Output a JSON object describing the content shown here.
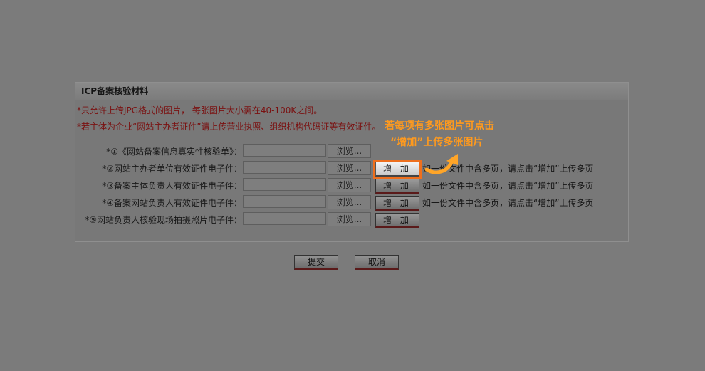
{
  "panel": {
    "title": "ICP备案核验材料",
    "notice1": "*只允许上传JPG格式的图片， 每张图片大小需在40-100K之间。",
    "notice2": "*若主体为企业“网站主办者证件”请上传营业执照、组织机构代码证等有效证件。"
  },
  "rows": [
    {
      "label": "*①《网站备案信息真实性核验单》：",
      "browse": "浏览...",
      "add": "",
      "hint": ""
    },
    {
      "label": "*②网站主办者单位有效证件电子件：",
      "browse": "浏览...",
      "add": "增 加",
      "hint": "如一份文件中含多页，请点击“增加”上传多页"
    },
    {
      "label": "*③备案主体负责人有效证件电子件：",
      "browse": "浏览...",
      "add": "增 加",
      "hint": "如一份文件中含多页，请点击“增加”上传多页"
    },
    {
      "label": "*④备案网站负责人有效证件电子件：",
      "browse": "浏览...",
      "add": "增 加",
      "hint": "如一份文件中含多页，请点击“增加”上传多页"
    },
    {
      "label": "*⑤网站负责人核验现场拍摄照片电子件：",
      "browse": "浏览...",
      "add": "增 加",
      "hint": ""
    }
  ],
  "actions": {
    "submit": "提交",
    "cancel": "取消"
  },
  "callout": {
    "line1": "若每项有多张图片可点击",
    "line2": "“增加”上传多张图片",
    "color": "#ff9a1e"
  }
}
